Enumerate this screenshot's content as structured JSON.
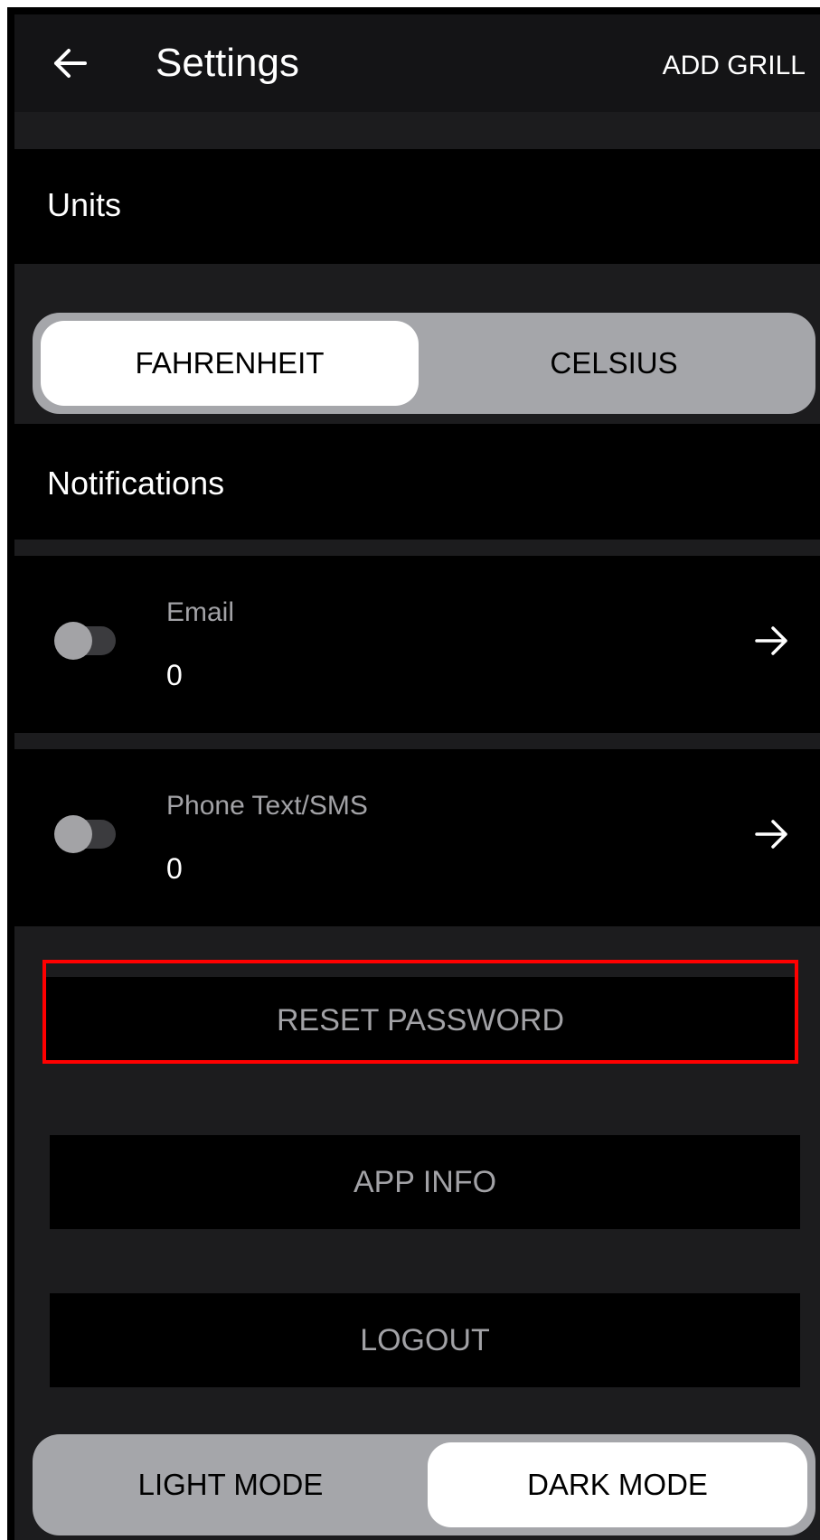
{
  "header": {
    "title": "Settings",
    "add_grill_label": "ADD GRILL",
    "back_icon": "arrow-left-icon"
  },
  "units": {
    "section_label": "Units",
    "options": [
      "FAHRENHEIT",
      "CELSIUS"
    ],
    "selected": "FAHRENHEIT"
  },
  "notifications": {
    "section_label": "Notifications",
    "items": [
      {
        "label": "Email",
        "value": "0",
        "enabled": false
      },
      {
        "label": "Phone Text/SMS",
        "value": "0",
        "enabled": false
      }
    ]
  },
  "actions": {
    "reset_password": "RESET PASSWORD",
    "app_info": "APP INFO",
    "logout": "LOGOUT"
  },
  "theme": {
    "options": [
      "LIGHT MODE",
      "DARK MODE"
    ],
    "selected": "DARK MODE"
  },
  "colors": {
    "background": "#1c1c1e",
    "panel": "#000000",
    "segment_track": "#a5a6aa",
    "highlight": "#ff0000"
  }
}
